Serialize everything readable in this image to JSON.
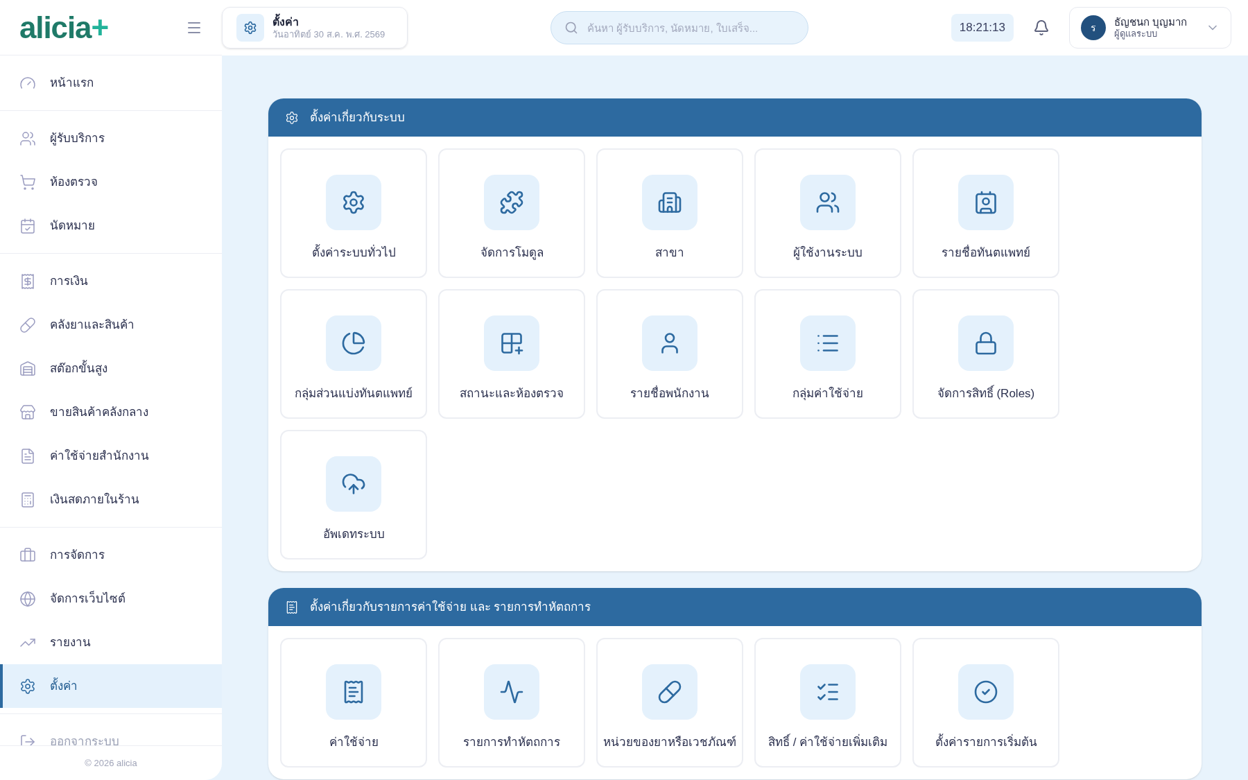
{
  "logo": {
    "text": "alicia",
    "mark": "+"
  },
  "header": {
    "page_title": "ตั้งค่า",
    "page_date": "วันอาทิตย์ 30 ส.ค. พ.ศ. 2569",
    "search": {
      "placeholder": "ค้นหา ผู้รับบริการ, นัดหมาย, ใบเสร็จ..."
    },
    "clock": "18:21:13",
    "user": {
      "initial": "ร",
      "name": "ธัญชนก บุญมาก",
      "role": "ผู้ดูแลระบบ"
    }
  },
  "sidebar": {
    "groups": [
      [
        {
          "label": "หน้าแรก",
          "selected": false
        }
      ],
      [
        {
          "label": "ผู้รับบริการ",
          "selected": false
        },
        {
          "label": "ห้องตรวจ",
          "selected": false
        },
        {
          "label": "นัดหมาย",
          "selected": false
        }
      ],
      [
        {
          "label": "การเงิน",
          "selected": false
        },
        {
          "label": "คลังยาและสินค้า",
          "selected": false
        },
        {
          "label": "สต๊อกขั้นสูง",
          "selected": false
        },
        {
          "label": "ขายสินค้าคลังกลาง",
          "selected": false
        },
        {
          "label": "ค่าใช้จ่ายสำนักงาน",
          "selected": false
        },
        {
          "label": "เงินสดภายในร้าน",
          "selected": false
        }
      ],
      [
        {
          "label": "การจัดการ",
          "selected": false
        },
        {
          "label": "จัดการเว็บไซต์",
          "selected": false
        },
        {
          "label": "รายงาน",
          "selected": false
        },
        {
          "label": "ตั้งค่า",
          "selected": true
        }
      ],
      [
        {
          "label": "ออกจากระบบ",
          "selected": false
        }
      ]
    ],
    "footer": "© 2026 alicia"
  },
  "sections": [
    {
      "title": "ตั้งค่าเกี่ยวกับระบบ",
      "tiles": [
        "ตั้งค่าระบบทั่วไป",
        "จัดการโมดูล",
        "สาขา",
        "ผู้ใช้งานระบบ",
        "รายชื่อทันตแพทย์",
        "กลุ่มส่วนแบ่งทันตแพทย์",
        "สถานะและห้องตรวจ",
        "รายชื่อพนักงาน",
        "กลุ่มค่าใช้จ่าย",
        "จัดการสิทธิ์ (Roles)",
        "อัพเดทระบบ"
      ]
    },
    {
      "title": "ตั้งค่าเกี่ยวกับรายการค่าใช้จ่าย และ รายการทำหัตถการ",
      "tiles": [
        "ค่าใช้จ่าย",
        "รายการทำหัตถการ",
        "หน่วยของยาหรือเวชภัณฑ์",
        "สิทธิ์ / ค่าใช้จ่ายเพิ่มเติม",
        "ตั้งค่ารายการเริ่มต้น"
      ]
    }
  ]
}
